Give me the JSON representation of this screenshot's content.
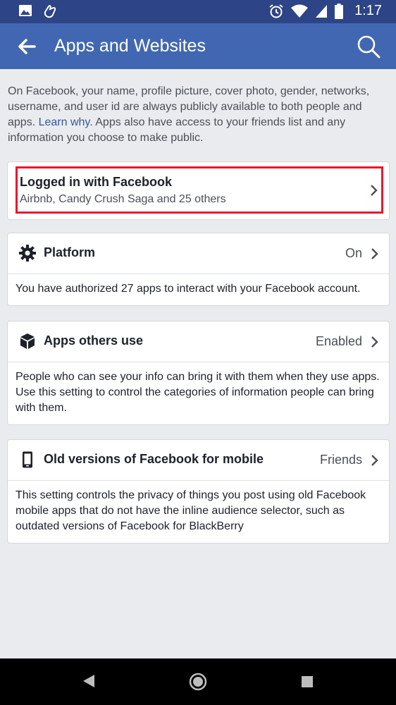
{
  "status_bar": {
    "time": "1:17",
    "icons": [
      "image-icon",
      "hand-icon",
      "alarm-icon",
      "wifi-icon",
      "signal-icon",
      "battery-icon"
    ]
  },
  "app_bar": {
    "title": "Apps and Websites",
    "back_icon": "back-arrow-icon",
    "search_icon": "search-icon",
    "color": "#4267b2"
  },
  "intro": {
    "text_before_link": "On Facebook, your name, profile picture, cover photo, gender, networks, username, and user id are always publicly available to both people and apps. ",
    "link": "Learn why",
    "text_after_link": ". Apps also have access to your friends list and any information you choose to make public."
  },
  "logged_in": {
    "title": "Logged in with Facebook",
    "subtitle": "Airbnb, Candy Crush Saga and 25 others",
    "highlight_color": "#e8182e"
  },
  "platform": {
    "label": "Platform",
    "value": "On",
    "icon": "gear-icon",
    "description": "You have authorized 27 apps to interact with your Facebook account."
  },
  "apps_others_use": {
    "label": "Apps others use",
    "value": "Enabled",
    "icon": "cube-icon",
    "description": "People who can see your info can bring it with them when they use apps. Use this setting to control the categories of information people can bring with them."
  },
  "old_versions": {
    "label": "Old versions of Facebook for mobile",
    "value": "Friends",
    "icon": "phone-icon",
    "description": "This setting controls the privacy of things you post using old Facebook mobile apps that do not have the inline audience selector, such as outdated versions of Facebook for BlackBerry"
  },
  "nav_bar": {
    "icons": [
      "back-triangle-icon",
      "home-circle-icon",
      "recents-square-icon"
    ]
  }
}
